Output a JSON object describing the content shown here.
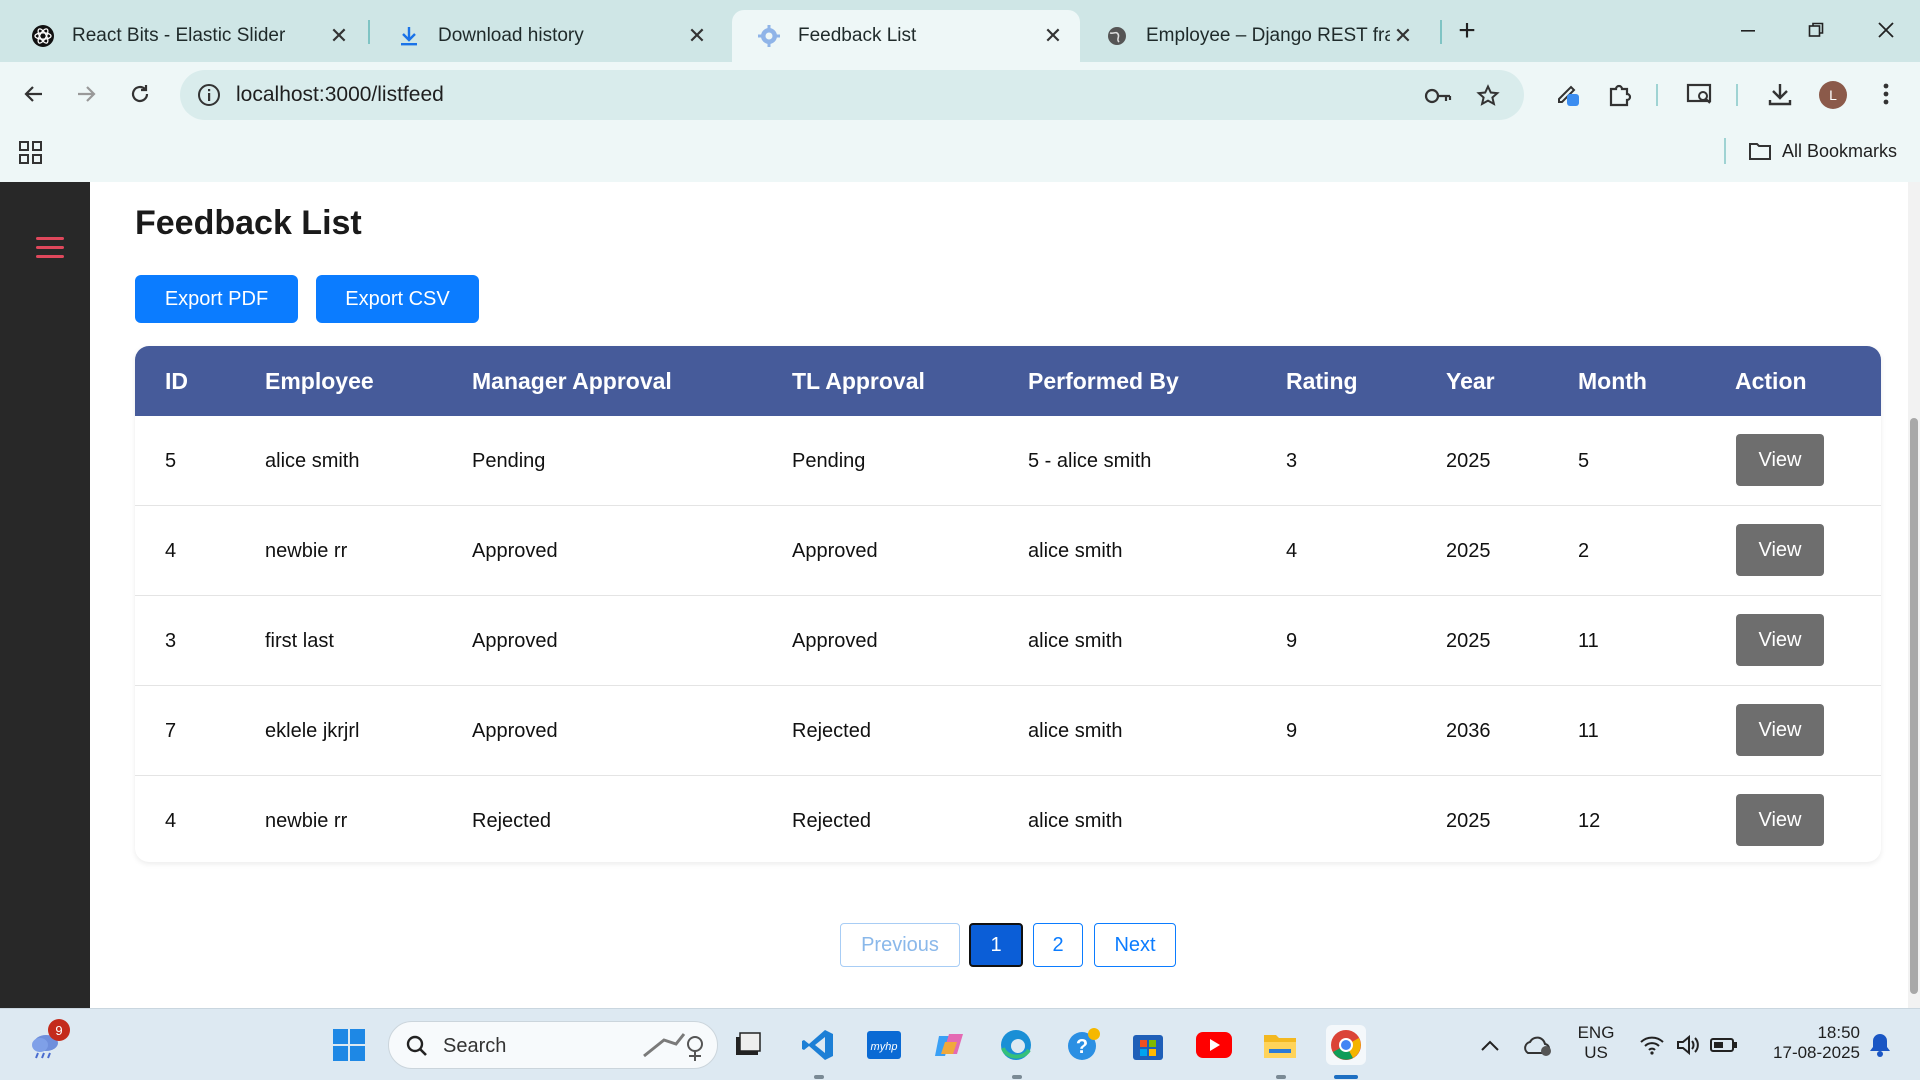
{
  "browser": {
    "tabs": [
      {
        "label": "React Bits - Elastic Slider",
        "icon": "react-bits-icon"
      },
      {
        "label": "Download history",
        "icon": "download-icon"
      },
      {
        "label": "Feedback List",
        "icon": "gear-icon",
        "active": true
      },
      {
        "label": "Employee – Django REST frame",
        "icon": "globe-icon"
      }
    ],
    "url": "localhost:3000/listfeed",
    "bookmarks_label": "All Bookmarks",
    "profile_initial": "L"
  },
  "page": {
    "title": "Feedback List",
    "export_pdf": "Export PDF",
    "export_csv": "Export CSV",
    "columns": [
      "ID",
      "Employee",
      "Manager Approval",
      "TL Approval",
      "Performed By",
      "Rating",
      "Year",
      "Month",
      "Action"
    ],
    "rows": [
      {
        "id": "5",
        "employee": "alice smith",
        "manager": "Pending",
        "tl": "Pending",
        "performed_by": "5 - alice smith",
        "rating": "3",
        "year": "2025",
        "month": "5",
        "action": "View"
      },
      {
        "id": "4",
        "employee": "newbie rr",
        "manager": "Approved",
        "tl": "Approved",
        "performed_by": "alice smith",
        "rating": "4",
        "year": "2025",
        "month": "2",
        "action": "View"
      },
      {
        "id": "3",
        "employee": "first last",
        "manager": "Approved",
        "tl": "Approved",
        "performed_by": "alice smith",
        "rating": "9",
        "year": "2025",
        "month": "11",
        "action": "View"
      },
      {
        "id": "7",
        "employee": "eklele jkrjrl",
        "manager": "Approved",
        "tl": "Rejected",
        "performed_by": "alice smith",
        "rating": "9",
        "year": "2036",
        "month": "11",
        "action": "View"
      },
      {
        "id": "4",
        "employee": "newbie rr",
        "manager": "Rejected",
        "tl": "Rejected",
        "performed_by": "alice smith",
        "rating": "",
        "year": "2025",
        "month": "12",
        "action": "View"
      }
    ],
    "pagination": {
      "previous": "Previous",
      "pages": [
        "1",
        "2"
      ],
      "current": "1",
      "next": "Next"
    }
  },
  "taskbar": {
    "search_placeholder": "Search",
    "weather_badge": "9",
    "lang_line1": "ENG",
    "lang_line2": "US",
    "time": "18:50",
    "date": "17-08-2025"
  },
  "colors": {
    "table_header": "#465b9a",
    "primary_button": "#0b7cff",
    "view_button": "#6e6e6e",
    "sidebar": "#282828",
    "hamburger": "#e0485c"
  }
}
